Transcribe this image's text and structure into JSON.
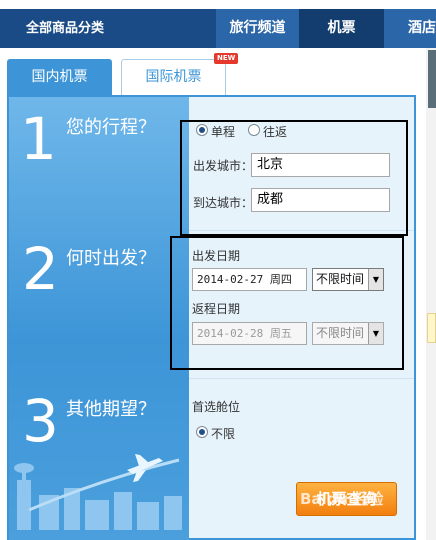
{
  "nav": {
    "all_categories": "全部商品分类",
    "travel": "旅行频道",
    "flight": "机票",
    "hotel": "酒店"
  },
  "tabs": {
    "domestic": "国内机票",
    "international": "国际机票",
    "new_badge": "NEW"
  },
  "steps": [
    {
      "num": "1",
      "title": "您的行程？"
    },
    {
      "num": "2",
      "title": "何时出发？"
    },
    {
      "num": "3",
      "title": "其他期望？"
    }
  ],
  "trip_type": {
    "one_way": "单程",
    "round_trip": "往返",
    "selected": "单程"
  },
  "cities": {
    "depart_label": "出发城市：",
    "depart_value": "北京",
    "arrive_label": "到达城市：",
    "arrive_value": "成都"
  },
  "dates": {
    "depart_label": "出发日期",
    "depart_value": "2014-02-27  周四",
    "depart_time": "不限时间",
    "return_label": "返程日期",
    "return_value": "2014-02-28  周五",
    "return_time": "不限时间"
  },
  "cabin": {
    "label": "首选舱位",
    "option": "不限"
  },
  "search_button": "机票查询",
  "watermark": "Baidu 经验",
  "colors": {
    "nav_bg": "#1f4f88",
    "panel_blue": "#3d95d7",
    "panel_bg": "#e6f3fb",
    "button_orange": "#f27f0f"
  }
}
